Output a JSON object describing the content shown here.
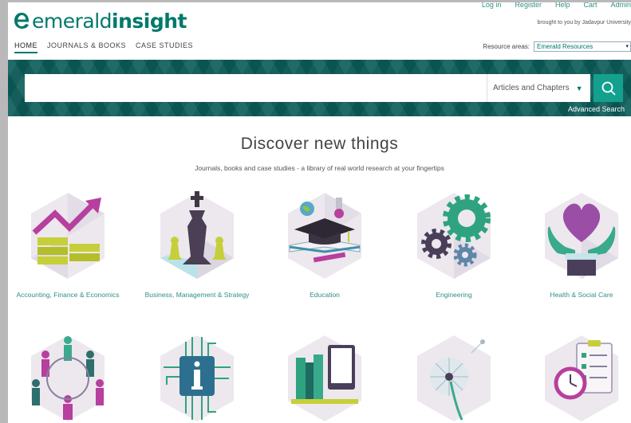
{
  "header": {
    "logo_light": "emerald",
    "logo_bold": "insight",
    "top_links": [
      "Log in",
      "Register",
      "Help",
      "Cart",
      "Admin"
    ],
    "brought_to_you": "brought to you by Jadavpur University",
    "nav": [
      "HOME",
      "JOURNALS & BOOKS",
      "CASE STUDIES"
    ],
    "resource_label": "Resource areas:",
    "resource_value": "Emerald Resources"
  },
  "search": {
    "placeholder": "",
    "scope": "Articles and Chapters",
    "advanced": "Advanced Search"
  },
  "discover": {
    "title": "Discover new things",
    "subtitle": "Journals, books and case studies - a library of real world research at your fingertips"
  },
  "tiles_row1": [
    {
      "label": "Accounting, Finance & Economics",
      "icon": "chart-coins-icon"
    },
    {
      "label": "Business, Management & Strategy",
      "icon": "chess-icon"
    },
    {
      "label": "Education",
      "icon": "graduation-cap-icon"
    },
    {
      "label": "Engineering",
      "icon": "gears-icon"
    },
    {
      "label": "Health & Social Care",
      "icon": "heart-hands-icon"
    }
  ],
  "tiles_row2": [
    {
      "icon": "people-circle-icon"
    },
    {
      "icon": "info-circuit-icon"
    },
    {
      "icon": "books-tablet-icon"
    },
    {
      "icon": "dandelion-icon"
    },
    {
      "icon": "clipboard-clock-icon"
    }
  ],
  "colors": {
    "brand": "#00796b",
    "band": "#0b5c59",
    "search_button": "#13a08f",
    "link": "#2f8f87"
  }
}
